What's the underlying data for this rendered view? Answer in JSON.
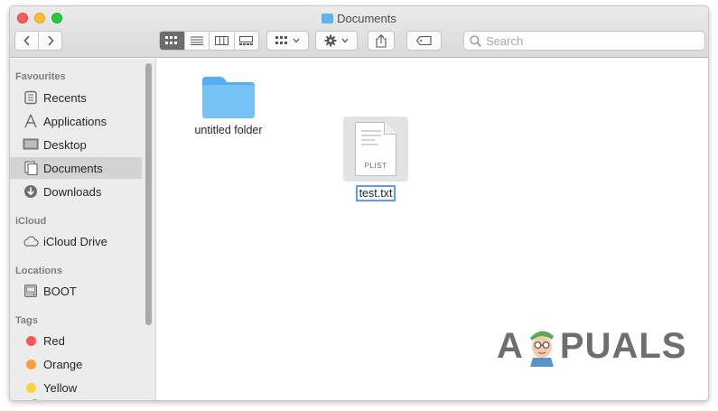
{
  "window": {
    "title": "Documents"
  },
  "toolbar": {
    "search_placeholder": "Search"
  },
  "sidebar": {
    "sections": {
      "favourites": "Favourites",
      "icloud": "iCloud",
      "locations": "Locations",
      "tags": "Tags"
    },
    "favourites": [
      {
        "label": "Recents",
        "icon": "clock-icon"
      },
      {
        "label": "Applications",
        "icon": "applications-icon"
      },
      {
        "label": "Desktop",
        "icon": "desktop-icon"
      },
      {
        "label": "Documents",
        "icon": "document-icon",
        "selected": true
      },
      {
        "label": "Downloads",
        "icon": "download-icon"
      }
    ],
    "icloud": [
      {
        "label": "iCloud Drive",
        "icon": "cloud-icon"
      }
    ],
    "locations": [
      {
        "label": "BOOT",
        "icon": "disk-icon"
      }
    ],
    "tags": [
      {
        "label": "Red",
        "color": "#fc5753"
      },
      {
        "label": "Orange",
        "color": "#fda034"
      },
      {
        "label": "Yellow",
        "color": "#fdd231"
      }
    ]
  },
  "files": [
    {
      "name": "untitled folder",
      "kind": "folder"
    },
    {
      "name": "test.txt",
      "kind": "document",
      "badge": "PLIST",
      "renaming": true
    }
  ],
  "watermark": {
    "left": "A",
    "right": "PUALS"
  }
}
